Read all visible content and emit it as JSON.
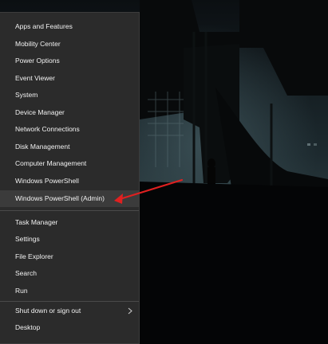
{
  "colors": {
    "menu_background": "#2b2b2b",
    "highlight": "#3b3b3b",
    "annotation_arrow": "#e02020"
  },
  "menu": {
    "items": [
      {
        "label": "Apps and Features"
      },
      {
        "label": "Mobility Center"
      },
      {
        "label": "Power Options"
      },
      {
        "label": "Event Viewer"
      },
      {
        "label": "System"
      },
      {
        "label": "Device Manager"
      },
      {
        "label": "Network Connections"
      },
      {
        "label": "Disk Management"
      },
      {
        "label": "Computer Management"
      },
      {
        "label": "Windows PowerShell"
      },
      {
        "label": "Windows PowerShell (Admin)"
      },
      {
        "label": "Task Manager"
      },
      {
        "label": "Settings"
      },
      {
        "label": "File Explorer"
      },
      {
        "label": "Search"
      },
      {
        "label": "Run"
      },
      {
        "label": "Shut down or sign out"
      },
      {
        "label": "Desktop"
      }
    ],
    "highlighted_item": "Windows PowerShell (Admin)",
    "submenu_icon": "chevron-right-icon"
  },
  "annotation": {
    "type": "arrow",
    "target": "Windows PowerShell (Admin)"
  }
}
